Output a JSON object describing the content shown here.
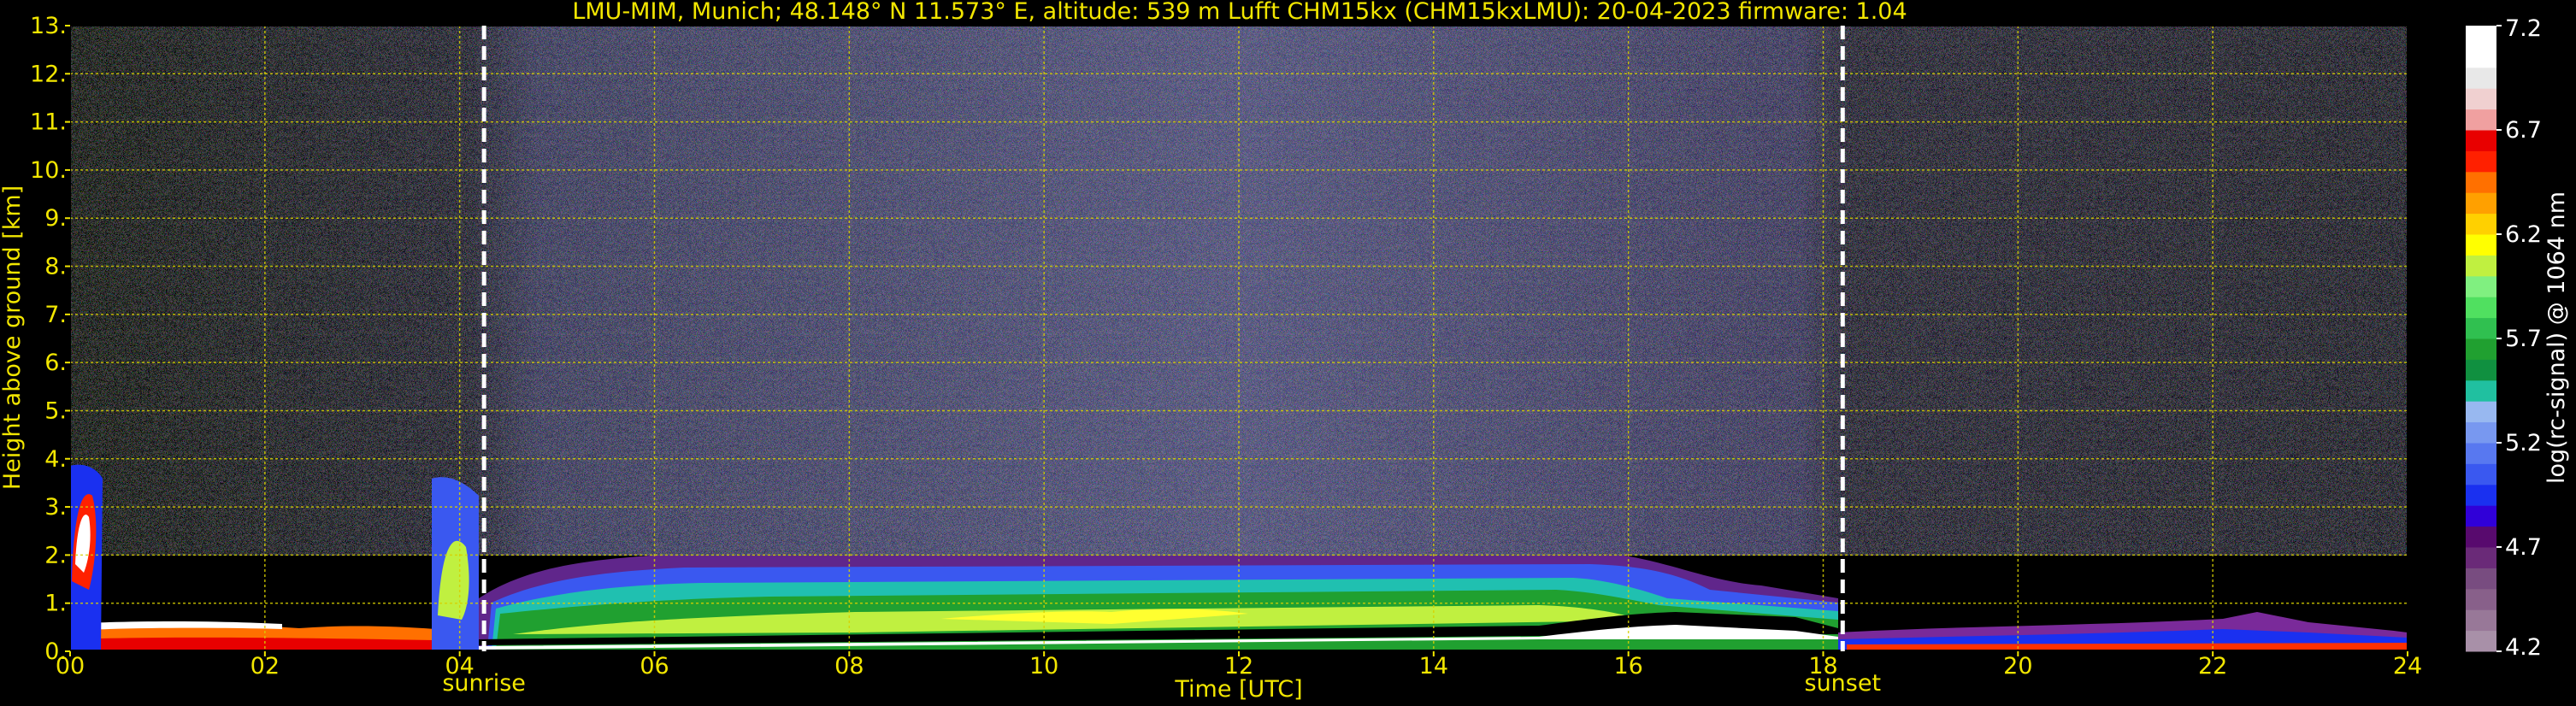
{
  "header": {
    "title": "LMU-MIM, Munich; 48.148° N 11.573° E, altitude: 539 m    Lufft CHM15kx (CHM15kxLMU): 20-04-2023    firmware: 1.04"
  },
  "colors": {
    "axis_text": "#f2e600",
    "grid": "#d8d000",
    "background": "#000000",
    "markers": "#ffffff"
  },
  "chart_data": {
    "type": "heatmap",
    "title": "LMU-MIM, Munich; 48.148° N 11.573° E, altitude: 539 m    Lufft CHM15kx (CHM15kxLMU): 20-04-2023    firmware: 1.04",
    "xlabel": "Time [UTC]",
    "ylabel": "Height above ground [km]",
    "xlim": [
      0,
      24
    ],
    "ylim": [
      0,
      13
    ],
    "x_ticks": [
      "00",
      "02",
      "04",
      "06",
      "08",
      "10",
      "12",
      "14",
      "16",
      "18",
      "20",
      "22",
      "24"
    ],
    "y_ticks": [
      "0.",
      "1.",
      "2.",
      "3.",
      "4.",
      "5.",
      "6.",
      "7.",
      "8.",
      "9.",
      "10.",
      "11.",
      "12.",
      "13."
    ],
    "grid": true,
    "markers": [
      {
        "label": "sunrise",
        "time": 4.25
      },
      {
        "label": "sunset",
        "time": 18.2
      }
    ],
    "colorbar": {
      "label": "log(rc-signal) @ 1064 nm",
      "min": 4.2,
      "max": 7.2,
      "ticks": [
        "4.2",
        "4.7",
        "5.2",
        "5.7",
        "6.2",
        "6.7",
        "7.2"
      ],
      "colors": [
        "#a890a8",
        "#987898",
        "#88608a",
        "#784c80",
        "#6a2a78",
        "#580a6e",
        "#3000d8",
        "#1a30f0",
        "#3a58f0",
        "#5878f0",
        "#7898f0",
        "#98b8f0",
        "#20c0a0",
        "#109040",
        "#20a030",
        "#30c050",
        "#50e060",
        "#80f080",
        "#c0f040",
        "#ffff00",
        "#ffd000",
        "#ffa000",
        "#ff7000",
        "#ff2000",
        "#e80000",
        "#f0a0a0",
        "#f0d0d0",
        "#e8e8e8",
        "#ffffff",
        "#ffffff"
      ]
    }
  }
}
